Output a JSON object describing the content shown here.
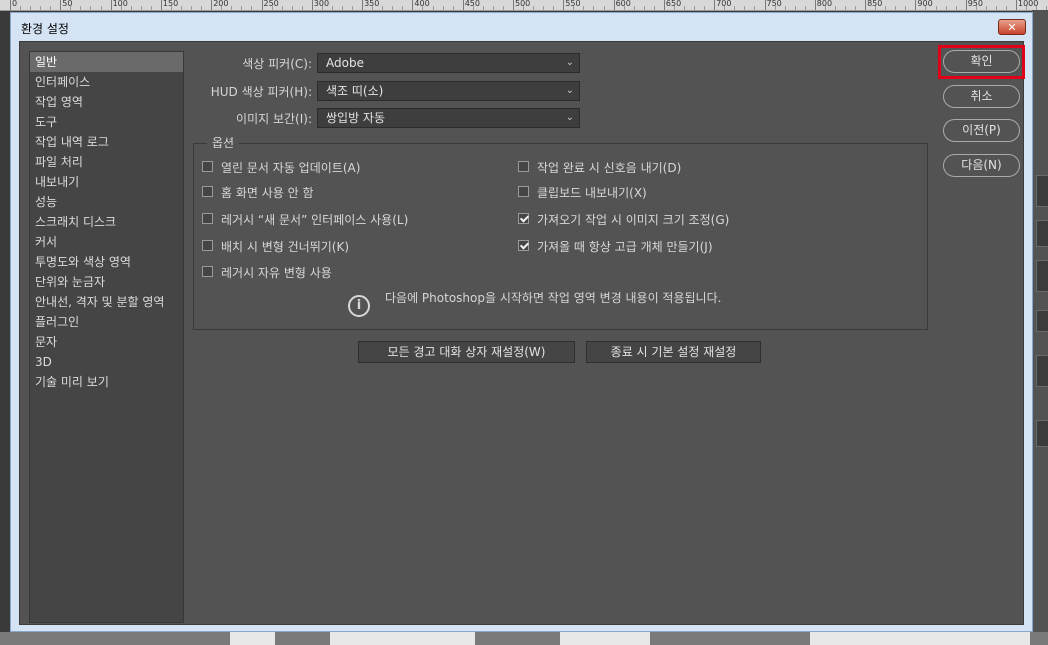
{
  "ruler": {
    "labels": [
      "0",
      "50",
      "100",
      "150",
      "200",
      "250",
      "300",
      "350",
      "400",
      "450",
      "500",
      "550",
      "600",
      "650",
      "700",
      "750",
      "800",
      "850",
      "900",
      "950",
      "1000"
    ]
  },
  "dialog": {
    "title": "환경 설정",
    "close_glyph": "✕"
  },
  "sidebar": {
    "items": [
      {
        "label": "일반",
        "selected": true
      },
      {
        "label": "인터페이스"
      },
      {
        "label": "작업 영역"
      },
      {
        "label": "도구"
      },
      {
        "label": "작업 내역 로그"
      },
      {
        "label": "파일 처리"
      },
      {
        "label": "내보내기"
      },
      {
        "label": "성능"
      },
      {
        "label": "스크래치 디스크"
      },
      {
        "label": "커서"
      },
      {
        "label": "투명도와 색상 영역"
      },
      {
        "label": "단위와 눈금자"
      },
      {
        "label": "안내선, 격자 및 분할 영역"
      },
      {
        "label": "플러그인"
      },
      {
        "label": "문자"
      },
      {
        "label": "3D"
      },
      {
        "label": "기술 미리 보기"
      }
    ]
  },
  "settings": {
    "color_picker": {
      "label": "색상 피커(C):",
      "value": "Adobe"
    },
    "hud_color_picker": {
      "label": "HUD 색상 피커(H):",
      "value": "색조 띠(소)"
    },
    "image_interpolation": {
      "label": "이미지 보간(I):",
      "value": "쌍입방 자동"
    }
  },
  "options": {
    "title": "옵션",
    "checkboxes": [
      {
        "label": "열린 문서 자동 업데이트(A)",
        "checked": false
      },
      {
        "label": "홈 화면 사용 안 함",
        "checked": false
      },
      {
        "label": "레거시 “새 문서” 인터페이스 사용(L)",
        "checked": false
      },
      {
        "label": "배치 시 변형 건너뛰기(K)",
        "checked": false
      },
      {
        "label": "레거시 자유 변형 사용",
        "checked": false
      },
      {
        "label": "작업 완료 시 신호음 내기(D)",
        "checked": false
      },
      {
        "label": "클립보드 내보내기(X)",
        "checked": false
      },
      {
        "label": "가져오기 작업 시 이미지 크기 조정(G)",
        "checked": true
      },
      {
        "label": "가져올 때 항상 고급 개체 만들기(J)",
        "checked": true
      }
    ],
    "info_icon": "i",
    "info": "다음에 Photoshop을 시작하면 작업 영역 변경 내용이 적용됩니다."
  },
  "buttons": {
    "reset_warnings": "모든 경고 대화 상자 재설정(W)",
    "reset_prefs": "종료 시 기본 설정 재설정",
    "ok": "확인",
    "cancel": "취소",
    "prev": "이전(P)",
    "next": "다음(N)"
  },
  "dropdown_arrow": "⌄",
  "colors": {
    "highlight": "#e0001a",
    "panel": "#535353",
    "sidebar": "#454545"
  }
}
